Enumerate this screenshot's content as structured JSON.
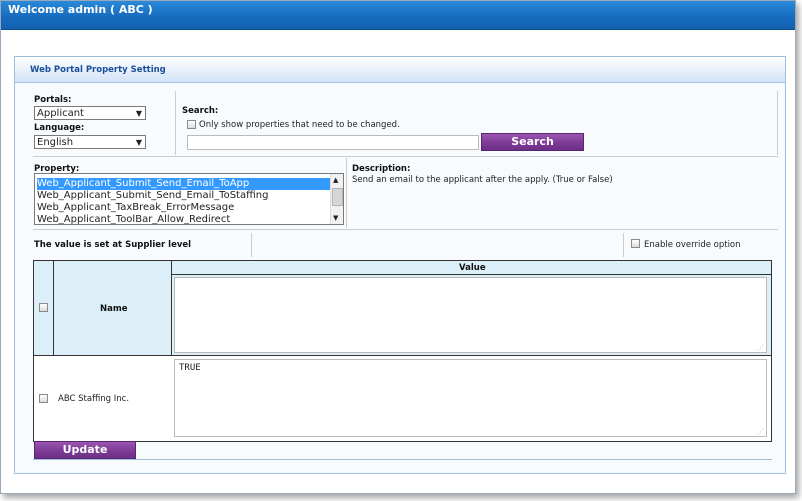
{
  "window": {
    "title": "Welcome admin ( ABC )"
  },
  "panel": {
    "header": "Web Portal Property Setting"
  },
  "portals": {
    "label": "Portals:",
    "selected": "Applicant"
  },
  "language": {
    "label": "Language:",
    "selected": "English"
  },
  "search": {
    "label": "Search:",
    "only_changed_label": "Only show properties that need to be changed.",
    "input_value": "",
    "button_label": "Search"
  },
  "property": {
    "label": "Property:",
    "items": [
      "Web_Applicant_Submit_Send_Email_ToApp",
      "Web_Applicant_Submit_Send_Email_ToStaffing",
      "Web_Applicant_TaxBreak_ErrorMessage",
      "Web_Applicant_ToolBar_Allow_Redirect"
    ],
    "selected_index": 0
  },
  "description": {
    "label": "Description:",
    "text": "Send an email to the applicant after the apply. (True or False)"
  },
  "level": {
    "text": "The value is set at Supplier level",
    "override_label": "Enable override option"
  },
  "grid": {
    "name_header": "Name",
    "value_header": "Value",
    "rows": [
      {
        "name": "ABC Staffing Inc.",
        "value": "TRUE"
      }
    ]
  },
  "update_button": "Update",
  "colors": {
    "titlebar": "#1a72c4",
    "button": "#7d3b96",
    "selection": "#3399ff"
  }
}
